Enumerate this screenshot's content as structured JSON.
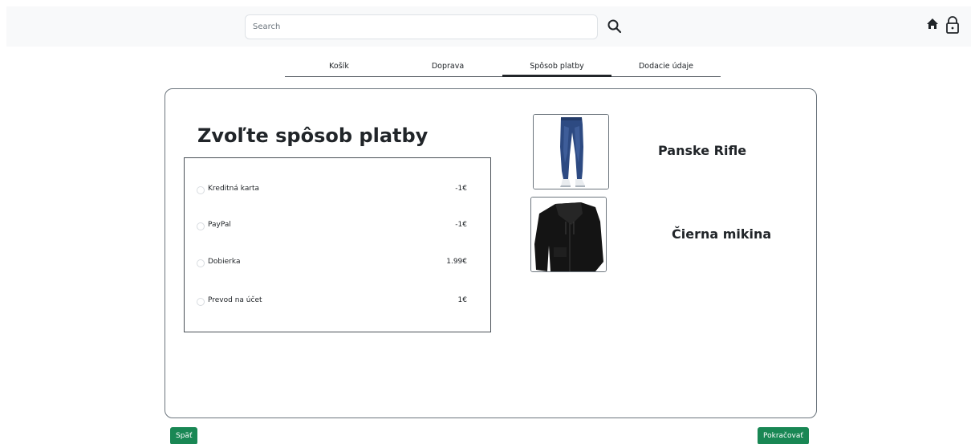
{
  "header": {
    "search": {
      "placeholder": "Search",
      "value": ""
    }
  },
  "steps": [
    {
      "label": "Košík",
      "active": false
    },
    {
      "label": "Doprava",
      "active": false
    },
    {
      "label": "Spôsob platby",
      "active": true
    },
    {
      "label": "Dodacie údaje",
      "active": false
    }
  ],
  "main": {
    "title": "Zvoľte spôsob platby",
    "payment_options": [
      {
        "label": "Kreditná karta",
        "price": "-1€",
        "selected": false
      },
      {
        "label": "PayPal",
        "price": "-1€",
        "selected": false
      },
      {
        "label": "Dobierka",
        "price": "1.99€",
        "selected": false
      },
      {
        "label": "Prevod na účet",
        "price": "1€",
        "selected": false
      }
    ]
  },
  "products": [
    {
      "name": "Panske Rifle",
      "image": "jeans"
    },
    {
      "name": "Čierna mikina",
      "image": "black-hoodie"
    }
  ],
  "footer": {
    "back_label": "Späť",
    "continue_label": "Pokračovať"
  },
  "colors": {
    "primary_button": "#198754",
    "header_bg": "#f8f9fa",
    "border": "#6c757d"
  }
}
